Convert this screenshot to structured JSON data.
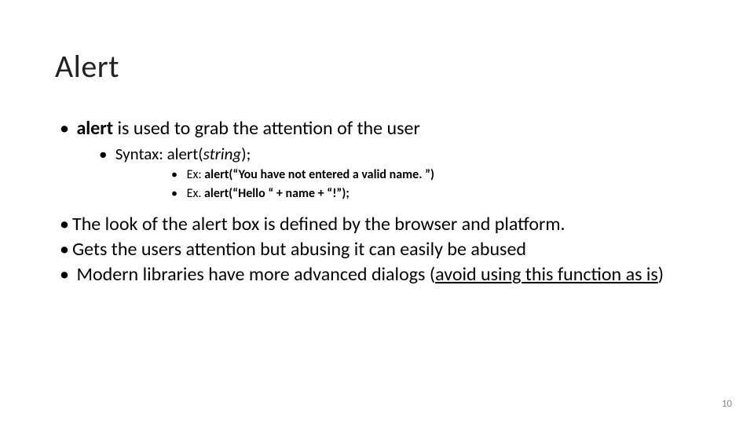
{
  "title": "Alert",
  "b1_bold": "alert",
  "b1_rest": " is used to grab the attention of the user",
  "b1a_pre": "Syntax: alert(",
  "b1a_italic": "string",
  "b1a_post": ");",
  "b1a_i_pre": "Ex: ",
  "b1a_i_bold": "alert(“You have not entered a valid name. ”)",
  "b1a_ii_pre": "Ex. ",
  "b1a_ii_bold": "alert(“Hello “ + name + “!”);",
  "b2": "The look of the alert box is defined by the browser and platform.",
  "b3": "Gets the users attention but abusing it can easily be abused",
  "b4_pre": "Modern libraries have more advanced dialogs (",
  "b4_under": "avoid using this function as is",
  "b4_post": ")",
  "page_number": "10"
}
